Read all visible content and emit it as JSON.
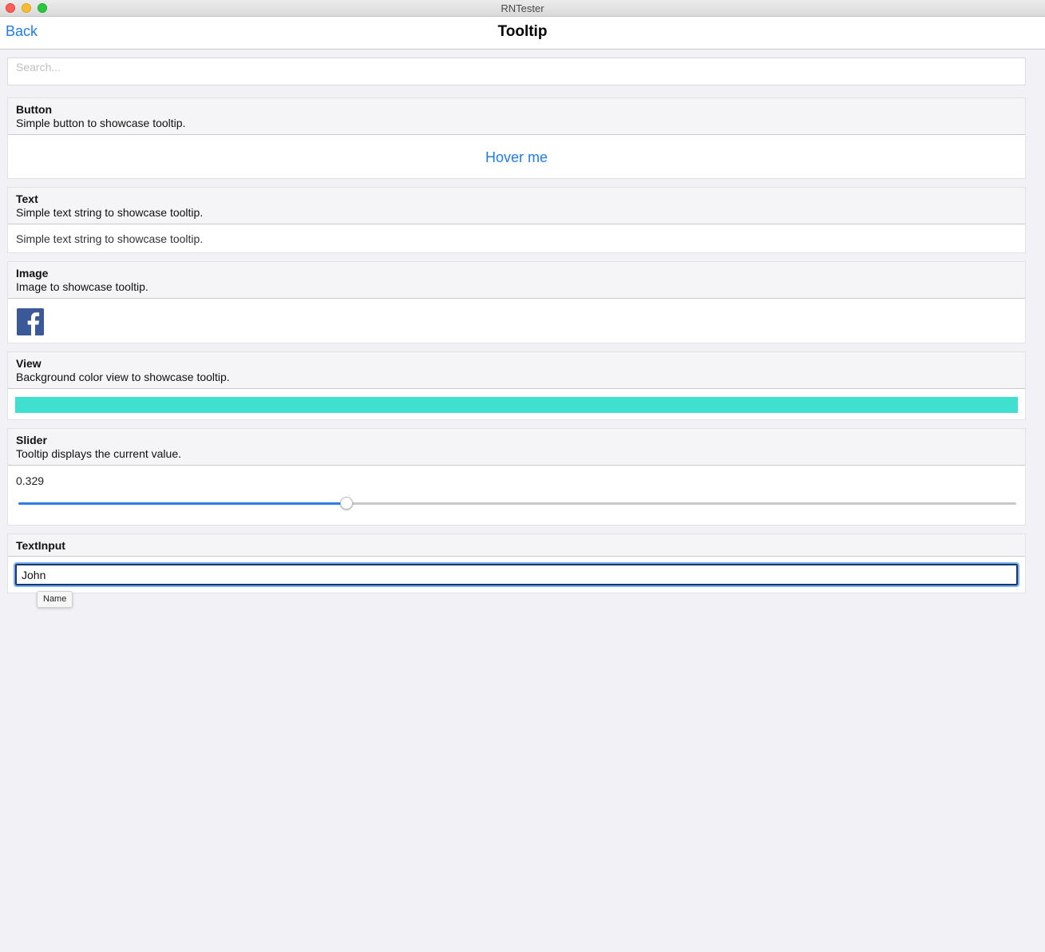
{
  "window": {
    "title": "RNTester"
  },
  "nav": {
    "back_label": "Back",
    "title": "Tooltip"
  },
  "search": {
    "placeholder": "Search...",
    "value": ""
  },
  "sections": {
    "button": {
      "title": "Button",
      "description": "Simple button to showcase tooltip.",
      "button_label": "Hover me"
    },
    "text": {
      "title": "Text",
      "description": "Simple text string to showcase tooltip.",
      "sample_text": "Simple text string to showcase tooltip."
    },
    "image": {
      "title": "Image",
      "description": "Image to showcase tooltip.",
      "icon": "facebook-icon"
    },
    "view": {
      "title": "View",
      "description": "Background color view to showcase tooltip.",
      "color": "#40e0d0"
    },
    "slider": {
      "title": "Slider",
      "description": "Tooltip displays the current value.",
      "value_text": "0.329",
      "value": 0.329
    },
    "textinput": {
      "title": "TextInput",
      "value": "John",
      "tooltip": "Name"
    }
  },
  "colors": {
    "accent": "#1e7cf0",
    "slider_fill": "#2b7de9",
    "background": "#f1f1f6"
  }
}
